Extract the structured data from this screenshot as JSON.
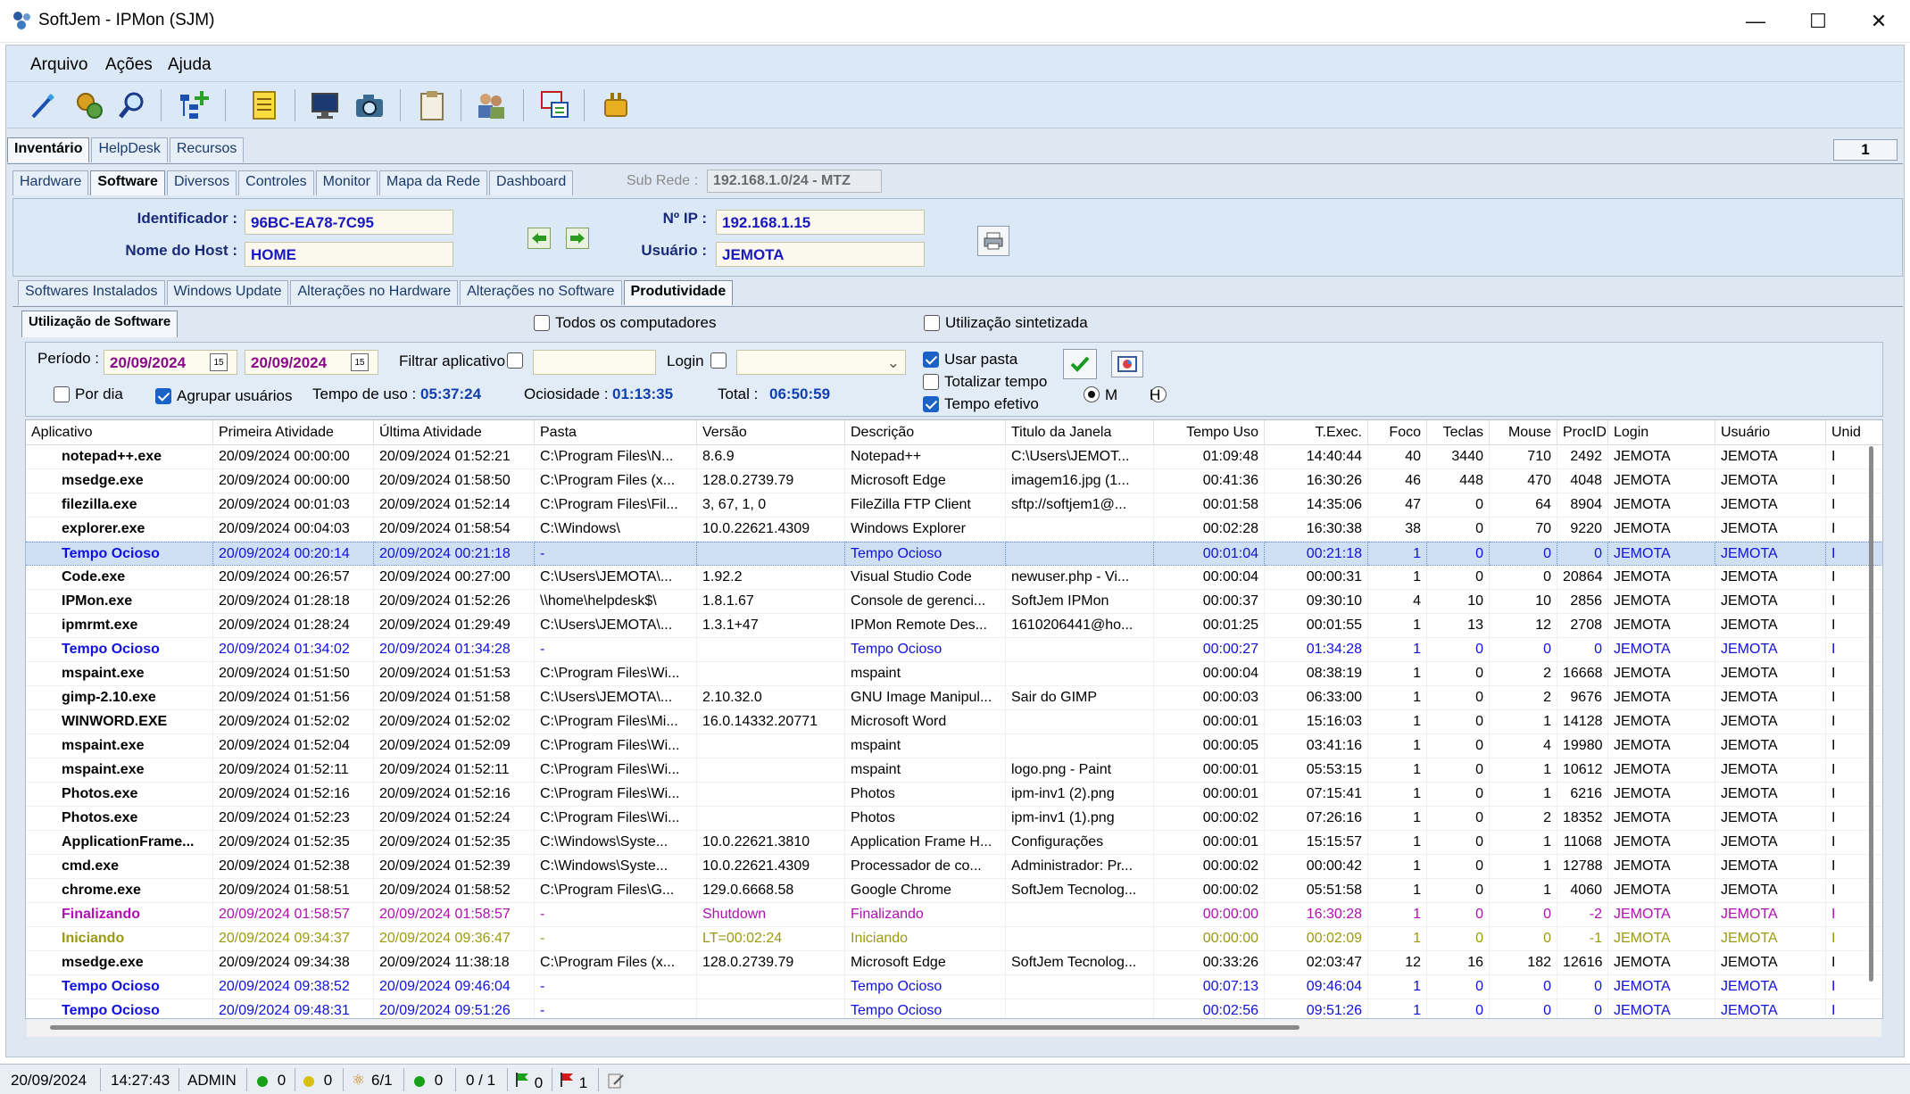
{
  "window": {
    "title": "SoftJem - IPMon (SJM)"
  },
  "menu": [
    "Arquivo",
    "Ações",
    "Ajuda"
  ],
  "toolbar_icons": [
    "wand-icon",
    "gears-icon",
    "magnifier-icon",
    "tree-add-icon",
    "notes-icon",
    "monitor-icon",
    "camera-icon",
    "clipboard-icon",
    "users-icon",
    "network-icon",
    "plugin-icon"
  ],
  "top_tabs": [
    "Inventário",
    "HelpDesk",
    "Recursos"
  ],
  "page_number": "1",
  "second_tabs": [
    "Hardware",
    "Software",
    "Diversos",
    "Controles",
    "Monitor",
    "Mapa da Rede",
    "Dashboard"
  ],
  "subnet": {
    "label": "Sub Rede :",
    "value": "192.168.1.0/24 - MTZ"
  },
  "host": {
    "id_label": "Identificador :",
    "id_value": "96BC-EA78-7C95",
    "host_label": "Nome do Host :",
    "host_value": "HOME",
    "ip_label": "Nº IP :",
    "ip_value": "192.168.1.15",
    "user_label": "Usuário :",
    "user_value": "JEMOTA"
  },
  "third_tabs": [
    "Softwares Instalados",
    "Windows Update",
    "Alterações no Hardware",
    "Alterações no Software",
    "Produtividade"
  ],
  "usage": {
    "tab": "Utilização de Software",
    "all_computers": "Todos os computadores",
    "synthesized": "Utilização sintetizada"
  },
  "filters": {
    "periodo_label": "Período :",
    "date_from": "20/09/2024",
    "date_to": "20/09/2024",
    "filtrar_label": "Filtrar aplicativo",
    "login_label": "Login",
    "usar_pasta": "Usar pasta",
    "totalizar_tempo": "Totalizar tempo",
    "tempo_efetivo": "Tempo efetivo",
    "por_dia": "Por dia",
    "agrupar": "Agrupar usuários",
    "tempo_uso_label": "Tempo de uso :",
    "tempo_uso": "05:37:24",
    "ociosidade_label": "Ociosidade :",
    "ociosidade": "01:13:35",
    "total_label": "Total :",
    "total": "06:50:59",
    "radio_m": "M",
    "radio_h": "H"
  },
  "columns": [
    "Aplicativo",
    "Primeira Atividade",
    "Última Atividade",
    "Pasta",
    "Versão",
    "Descrição",
    "Titulo da Janela",
    "Tempo Uso",
    "T.Exec.",
    "Foco",
    "Teclas",
    "Mouse",
    "ProcID",
    "Login",
    "Usuário",
    "Unid"
  ],
  "rows": [
    {
      "c": [
        "notepad++.exe",
        "20/09/2024 00:00:00",
        "20/09/2024 01:52:21",
        "C:\\Program Files\\N...",
        "8.6.9",
        "Notepad++",
        "C:\\Users\\JEMOT...",
        "01:09:48",
        "14:40:44",
        "40",
        "3440",
        "710",
        "2492",
        "JEMOTA",
        "JEMOTA",
        "I"
      ],
      "t": "n"
    },
    {
      "c": [
        "msedge.exe",
        "20/09/2024 00:00:00",
        "20/09/2024 01:58:50",
        "C:\\Program Files (x...",
        "128.0.2739.79",
        "Microsoft Edge",
        "imagem16.jpg (1...",
        "00:41:36",
        "16:30:26",
        "46",
        "448",
        "470",
        "4048",
        "JEMOTA",
        "JEMOTA",
        "I"
      ],
      "t": "n"
    },
    {
      "c": [
        "filezilla.exe",
        "20/09/2024 00:01:03",
        "20/09/2024 01:52:14",
        "C:\\Program Files\\Fil...",
        "3, 67, 1, 0",
        "FileZilla FTP Client",
        "sftp://softjem1@...",
        "00:01:58",
        "14:35:06",
        "47",
        "0",
        "64",
        "8904",
        "JEMOTA",
        "JEMOTA",
        "I"
      ],
      "t": "n"
    },
    {
      "c": [
        "explorer.exe",
        "20/09/2024 00:04:03",
        "20/09/2024 01:58:54",
        "C:\\Windows\\",
        "10.0.22621.4309",
        "Windows Explorer",
        "",
        "00:02:28",
        "16:30:38",
        "38",
        "0",
        "70",
        "9220",
        "JEMOTA",
        "JEMOTA",
        "I"
      ],
      "t": "n"
    },
    {
      "c": [
        "Tempo Ocioso",
        "20/09/2024 00:20:14",
        "20/09/2024 00:21:18",
        "-",
        "",
        "Tempo Ocioso",
        "",
        "00:01:04",
        "00:21:18",
        "1",
        "0",
        "0",
        "0",
        "JEMOTA",
        "JEMOTA",
        "I"
      ],
      "t": "sel"
    },
    {
      "c": [
        "Code.exe",
        "20/09/2024 00:26:57",
        "20/09/2024 00:27:00",
        "C:\\Users\\JEMOTA\\...",
        "1.92.2",
        "Visual Studio Code",
        "newuser.php - Vi...",
        "00:00:04",
        "00:00:31",
        "1",
        "0",
        "0",
        "20864",
        "JEMOTA",
        "JEMOTA",
        "I"
      ],
      "t": "n"
    },
    {
      "c": [
        "IPMon.exe",
        "20/09/2024 01:28:18",
        "20/09/2024 01:52:26",
        "\\\\home\\helpdesk$\\",
        "1.8.1.67",
        "Console de gerenci...",
        "SoftJem IPMon",
        "00:00:37",
        "09:30:10",
        "4",
        "10",
        "10",
        "2856",
        "JEMOTA",
        "JEMOTA",
        "I"
      ],
      "t": "n"
    },
    {
      "c": [
        "ipmrmt.exe",
        "20/09/2024 01:28:24",
        "20/09/2024 01:29:49",
        "C:\\Users\\JEMOTA\\...",
        "1.3.1+47",
        "IPMon Remote Des...",
        "1610206441@ho...",
        "00:01:25",
        "00:01:55",
        "1",
        "13",
        "12",
        "2708",
        "JEMOTA",
        "JEMOTA",
        "I"
      ],
      "t": "n"
    },
    {
      "c": [
        "Tempo Ocioso",
        "20/09/2024 01:34:02",
        "20/09/2024 01:34:28",
        "-",
        "",
        "Tempo Ocioso",
        "",
        "00:00:27",
        "01:34:28",
        "1",
        "0",
        "0",
        "0",
        "JEMOTA",
        "JEMOTA",
        "I"
      ],
      "t": "idle"
    },
    {
      "c": [
        "mspaint.exe",
        "20/09/2024 01:51:50",
        "20/09/2024 01:51:53",
        "C:\\Program Files\\Wi...",
        "",
        "mspaint",
        "",
        "00:00:04",
        "08:38:19",
        "1",
        "0",
        "2",
        "16668",
        "JEMOTA",
        "JEMOTA",
        "I"
      ],
      "t": "n"
    },
    {
      "c": [
        "gimp-2.10.exe",
        "20/09/2024 01:51:56",
        "20/09/2024 01:51:58",
        "C:\\Users\\JEMOTA\\...",
        "2.10.32.0",
        "GNU Image Manipul...",
        "Sair do GIMP",
        "00:00:03",
        "06:33:00",
        "1",
        "0",
        "2",
        "9676",
        "JEMOTA",
        "JEMOTA",
        "I"
      ],
      "t": "n"
    },
    {
      "c": [
        "WINWORD.EXE",
        "20/09/2024 01:52:02",
        "20/09/2024 01:52:02",
        "C:\\Program Files\\Mi...",
        "16.0.14332.20771",
        "Microsoft Word",
        "",
        "00:00:01",
        "15:16:03",
        "1",
        "0",
        "1",
        "14128",
        "JEMOTA",
        "JEMOTA",
        "I"
      ],
      "t": "n"
    },
    {
      "c": [
        "mspaint.exe",
        "20/09/2024 01:52:04",
        "20/09/2024 01:52:09",
        "C:\\Program Files\\Wi...",
        "",
        "mspaint",
        "",
        "00:00:05",
        "03:41:16",
        "1",
        "0",
        "4",
        "19980",
        "JEMOTA",
        "JEMOTA",
        "I"
      ],
      "t": "n"
    },
    {
      "c": [
        "mspaint.exe",
        "20/09/2024 01:52:11",
        "20/09/2024 01:52:11",
        "C:\\Program Files\\Wi...",
        "",
        "mspaint",
        "logo.png - Paint",
        "00:00:01",
        "05:53:15",
        "1",
        "0",
        "1",
        "10612",
        "JEMOTA",
        "JEMOTA",
        "I"
      ],
      "t": "n"
    },
    {
      "c": [
        "Photos.exe",
        "20/09/2024 01:52:16",
        "20/09/2024 01:52:16",
        "C:\\Program Files\\Wi...",
        "",
        "Photos",
        "ipm-inv1 (2).png",
        "00:00:01",
        "07:15:41",
        "1",
        "0",
        "1",
        "6216",
        "JEMOTA",
        "JEMOTA",
        "I"
      ],
      "t": "n"
    },
    {
      "c": [
        "Photos.exe",
        "20/09/2024 01:52:23",
        "20/09/2024 01:52:24",
        "C:\\Program Files\\Wi...",
        "",
        "Photos",
        "ipm-inv1 (1).png",
        "00:00:02",
        "07:26:16",
        "1",
        "0",
        "2",
        "18352",
        "JEMOTA",
        "JEMOTA",
        "I"
      ],
      "t": "n"
    },
    {
      "c": [
        "ApplicationFrame...",
        "20/09/2024 01:52:35",
        "20/09/2024 01:52:35",
        "C:\\Windows\\Syste...",
        "10.0.22621.3810",
        "Application Frame H...",
        "Configurações",
        "00:00:01",
        "15:15:57",
        "1",
        "0",
        "1",
        "11068",
        "JEMOTA",
        "JEMOTA",
        "I"
      ],
      "t": "n"
    },
    {
      "c": [
        "cmd.exe",
        "20/09/2024 01:52:38",
        "20/09/2024 01:52:39",
        "C:\\Windows\\Syste...",
        "10.0.22621.4309",
        "Processador de co...",
        "Administrador: Pr...",
        "00:00:02",
        "00:00:42",
        "1",
        "0",
        "1",
        "12788",
        "JEMOTA",
        "JEMOTA",
        "I"
      ],
      "t": "n"
    },
    {
      "c": [
        "chrome.exe",
        "20/09/2024 01:58:51",
        "20/09/2024 01:58:52",
        "C:\\Program Files\\G...",
        "129.0.6668.58",
        "Google Chrome",
        "SoftJem Tecnolog...",
        "00:00:02",
        "05:51:58",
        "1",
        "0",
        "1",
        "4060",
        "JEMOTA",
        "JEMOTA",
        "I"
      ],
      "t": "n"
    },
    {
      "c": [
        "Finalizando",
        "20/09/2024 01:58:57",
        "20/09/2024 01:58:57",
        "-",
        "Shutdown",
        "Finalizando",
        "",
        "00:00:00",
        "16:30:28",
        "1",
        "0",
        "0",
        "-2",
        "JEMOTA",
        "JEMOTA",
        "I"
      ],
      "t": "fin"
    },
    {
      "c": [
        "Iniciando",
        "20/09/2024 09:34:37",
        "20/09/2024 09:36:47",
        "-",
        "LT=00:02:24",
        "Iniciando",
        "",
        "00:00:00",
        "00:02:09",
        "1",
        "0",
        "0",
        "-1",
        "JEMOTA",
        "JEMOTA",
        "I"
      ],
      "t": "ini"
    },
    {
      "c": [
        "msedge.exe",
        "20/09/2024 09:34:38",
        "20/09/2024 11:38:18",
        "C:\\Program Files (x...",
        "128.0.2739.79",
        "Microsoft Edge",
        "SoftJem Tecnolog...",
        "00:33:26",
        "02:03:47",
        "12",
        "16",
        "182",
        "12616",
        "JEMOTA",
        "JEMOTA",
        "I"
      ],
      "t": "n"
    },
    {
      "c": [
        "Tempo Ocioso",
        "20/09/2024 09:38:52",
        "20/09/2024 09:46:04",
        "-",
        "",
        "Tempo Ocioso",
        "",
        "00:07:13",
        "09:46:04",
        "1",
        "0",
        "0",
        "0",
        "JEMOTA",
        "JEMOTA",
        "I"
      ],
      "t": "idle"
    },
    {
      "c": [
        "Tempo Ocioso",
        "20/09/2024 09:48:31",
        "20/09/2024 09:51:26",
        "-",
        "",
        "Tempo Ocioso",
        "",
        "00:02:56",
        "09:51:26",
        "1",
        "0",
        "0",
        "0",
        "JEMOTA",
        "JEMOTA",
        "I"
      ],
      "t": "idle"
    }
  ],
  "status": {
    "date": "20/09/2024",
    "time": "14:27:43",
    "user": "ADMIN",
    "green_count": "0",
    "yellow_count": "0",
    "plugin_count": "6/1",
    "green2_count": "0",
    "ratio": "0 / 1",
    "flag_green": "0",
    "flag_red": "1"
  },
  "colors": {
    "idle": "#1010e0",
    "finalizando": "#b010b0",
    "iniciando": "#9a9a10",
    "selected_bg": "#cfe0f5"
  }
}
